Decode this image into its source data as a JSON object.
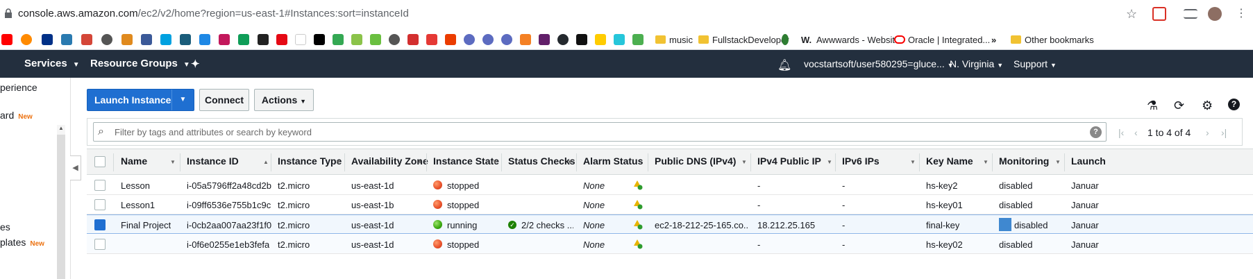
{
  "browser": {
    "url_host": "console.aws.amazon.com",
    "url_path": "/ec2/v2/home?region=us-east-1#Instances:sort=instanceId"
  },
  "bookmarks": {
    "music": "music",
    "fullstack": "FullstackDeveloper",
    "awwwards": "Awwwards - Websit...",
    "oracle": "Oracle | Integrated...",
    "more": "»",
    "other": "Other bookmarks"
  },
  "nav": {
    "services": "Services",
    "resource_groups": "Resource Groups",
    "account": "vocstartsoft/user580295=gluce...",
    "region": "N. Virginia",
    "support": "Support",
    "caret": "⌄"
  },
  "sidebar": {
    "experience": "perience",
    "dashboard": "ard",
    "new_label": "New",
    "templates": "plates",
    "es": "es"
  },
  "toolbar": {
    "launch": "Launch Instance",
    "connect": "Connect",
    "actions": "Actions"
  },
  "filter": {
    "placeholder": "Filter by tags and attributes or search by keyword",
    "help": "?",
    "pagination": "1 to 4 of 4"
  },
  "columns": [
    "Name",
    "Instance ID",
    "Instance Type",
    "Availability Zone",
    "Instance State",
    "Status Checks",
    "Alarm Status",
    "Public DNS (IPv4)",
    "IPv4 Public IP",
    "IPv6 IPs",
    "Key Name",
    "Monitoring",
    "Launch"
  ],
  "instances": [
    {
      "name": "Lesson",
      "id": "i-05a5796ff2a48cd2b",
      "type": "t2.micro",
      "az": "us-east-1d",
      "state": "stopped",
      "checks": "",
      "alarm": "None",
      "dns": "",
      "ip": "-",
      "ipv6": "-",
      "key": "hs-key2",
      "monitoring": "disabled",
      "launch": "Januar"
    },
    {
      "name": "Lesson1",
      "id": "i-09ff6536e755b1c9c",
      "type": "t2.micro",
      "az": "us-east-1b",
      "state": "stopped",
      "checks": "",
      "alarm": "None",
      "dns": "",
      "ip": "-",
      "ipv6": "-",
      "key": "hs-key01",
      "monitoring": "disabled",
      "launch": "Januar"
    },
    {
      "name": "Final Project",
      "id": "i-0cb2aa007aa23f1f0",
      "type": "t2.micro",
      "az": "us-east-1d",
      "state": "running",
      "checks": "2/2 checks ...",
      "alarm": "None",
      "dns": "ec2-18-212-25-165.co...",
      "ip": "18.212.25.165",
      "ipv6": "-",
      "key": "final-key",
      "monitoring": "disabled",
      "launch": "Januar"
    },
    {
      "name": "",
      "id": "i-0f6e0255e1eb3fefa",
      "type": "t2.micro",
      "az": "us-east-1d",
      "state": "stopped",
      "checks": "",
      "alarm": "None",
      "dns": "",
      "ip": "-",
      "ipv6": "-",
      "key": "hs-key02",
      "monitoring": "disabled",
      "launch": "Januar"
    }
  ],
  "colors": {
    "navbar": "#232f3e",
    "primary": "#1f6fd1",
    "running": "#3aa80f",
    "stopped": "#e8502a"
  }
}
